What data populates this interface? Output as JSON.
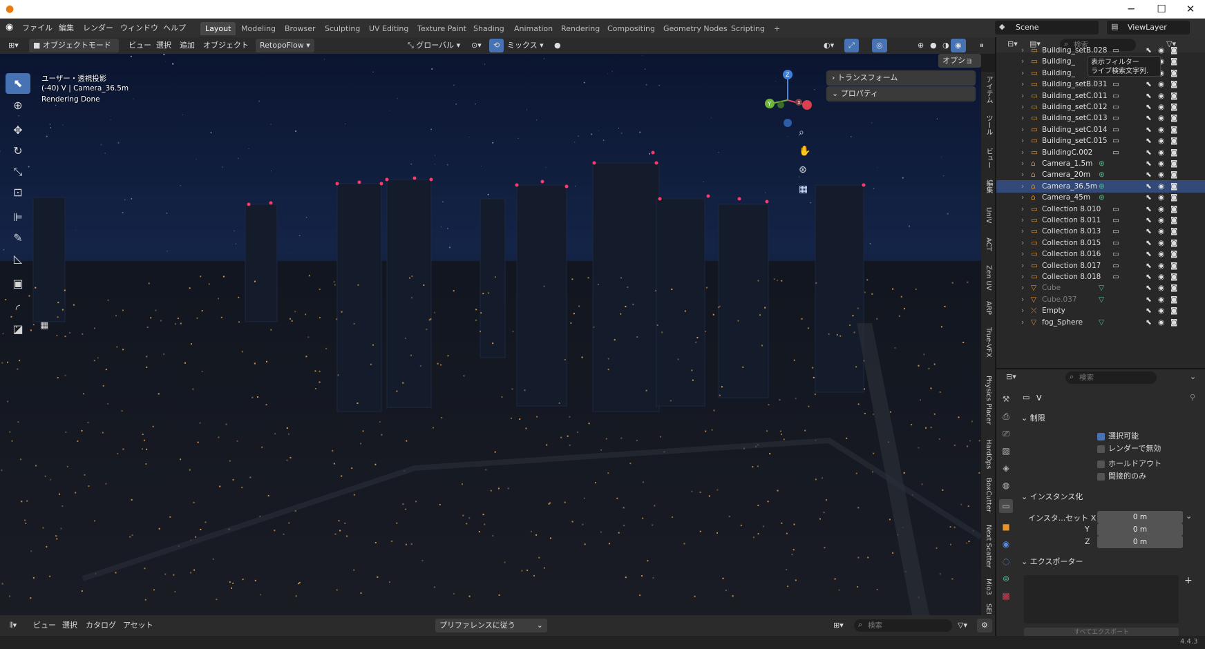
{
  "titlebar": {
    "minimize": "─",
    "maximize": "☐",
    "close": "✕"
  },
  "menus": [
    "ファイル",
    "編集",
    "レンダー",
    "ウィンドウ",
    "ヘルプ"
  ],
  "workspaces": [
    "Layout",
    "Modeling",
    "Browser",
    "Sculpting",
    "UV Editing",
    "Texture Paint",
    "Shading",
    "Animation",
    "Rendering",
    "Compositing",
    "Geometry Nodes",
    "Scripting"
  ],
  "active_workspace": "Layout",
  "add_workspace": "+",
  "scene": {
    "name": "Scene",
    "viewlayer": "ViewLayer"
  },
  "header": {
    "mode": "オブジェクトモード",
    "menu_items": [
      "ビュー",
      "選択",
      "追加",
      "オブジェクト"
    ],
    "retopoflow": "RetopoFlow",
    "transform_orientation": "グローバル",
    "pivot": "ミックス",
    "options": "オプション"
  },
  "viewport": {
    "projection": "ユーザー・透視投影",
    "collection_info": "(-40) V | Camera_36.5m",
    "status": "Rendering Done"
  },
  "gizmo": {
    "x": "X",
    "y": "Y",
    "z": "Z"
  },
  "npanel": {
    "transform": "トランスフォーム",
    "properties": "プロパティ"
  },
  "sidebar_tabs": [
    "アイテム",
    "ツール",
    "ビュー",
    "編集",
    "UnIV",
    "ACT",
    "Zen UV",
    "ARP",
    "True-VFX",
    "Physics Placer",
    "HardOps",
    "BoxCutter",
    "Next Scatter",
    "Mio3",
    "SEI"
  ],
  "outliner": {
    "search_placeholder": "検索",
    "tooltip": [
      "表示フィルター",
      "ライブ検索文字列."
    ],
    "items": [
      {
        "name": "Building_setB.028",
        "type": "collection"
      },
      {
        "name": "Building_",
        "type": "collection"
      },
      {
        "name": "Building_",
        "type": "collection"
      },
      {
        "name": "Building_setB.031",
        "type": "collection"
      },
      {
        "name": "Building_setC.011",
        "type": "collection"
      },
      {
        "name": "Building_setC.012",
        "type": "collection"
      },
      {
        "name": "Building_setC.013",
        "type": "collection"
      },
      {
        "name": "Building_setC.014",
        "type": "collection"
      },
      {
        "name": "Building_setC.015",
        "type": "collection"
      },
      {
        "name": "BuildingC.002",
        "type": "collection"
      },
      {
        "name": "Camera_1.5m",
        "type": "camera"
      },
      {
        "name": "Camera_20m",
        "type": "camera"
      },
      {
        "name": "Camera_36.5m",
        "type": "camera",
        "selected": true
      },
      {
        "name": "Camera_45m",
        "type": "camera"
      },
      {
        "name": "Collection 8.010",
        "type": "collection"
      },
      {
        "name": "Collection 8.011",
        "type": "collection"
      },
      {
        "name": "Collection 8.013",
        "type": "collection"
      },
      {
        "name": "Collection 8.015",
        "type": "collection"
      },
      {
        "name": "Collection 8.016",
        "type": "collection"
      },
      {
        "name": "Collection 8.017",
        "type": "collection"
      },
      {
        "name": "Collection 8.018",
        "type": "collection"
      },
      {
        "name": "Cube",
        "type": "mesh",
        "dim": true
      },
      {
        "name": "Cube.037",
        "type": "mesh",
        "dim": true
      },
      {
        "name": "Empty",
        "type": "empty"
      },
      {
        "name": "fog_Sphere",
        "type": "mesh"
      }
    ]
  },
  "properties": {
    "search_placeholder": "検索",
    "object_name": "V",
    "restrictions": {
      "title": "制限",
      "items": [
        {
          "label": "選択可能",
          "checked": true
        },
        {
          "label": "レンダーで無効",
          "checked": false
        },
        {
          "label": "ホールドアウト",
          "checked": false
        },
        {
          "label": "間接的のみ",
          "checked": false
        }
      ]
    },
    "instancing": {
      "title": "インスタンス化",
      "offset_label": "インスタ...セット X",
      "y_label": "Y",
      "z_label": "Z",
      "x": "0 m",
      "y": "0 m",
      "z": "0 m"
    },
    "exporter": {
      "title": "エクスポーター",
      "export_all": "すべてエクスポート"
    }
  },
  "bottom": {
    "menu_items": [
      "ビュー",
      "選択",
      "カタログ",
      "アセット"
    ],
    "preference": "プリファレンスに従う",
    "search_placeholder": "検索"
  },
  "status": {
    "version": "4.4.3"
  }
}
